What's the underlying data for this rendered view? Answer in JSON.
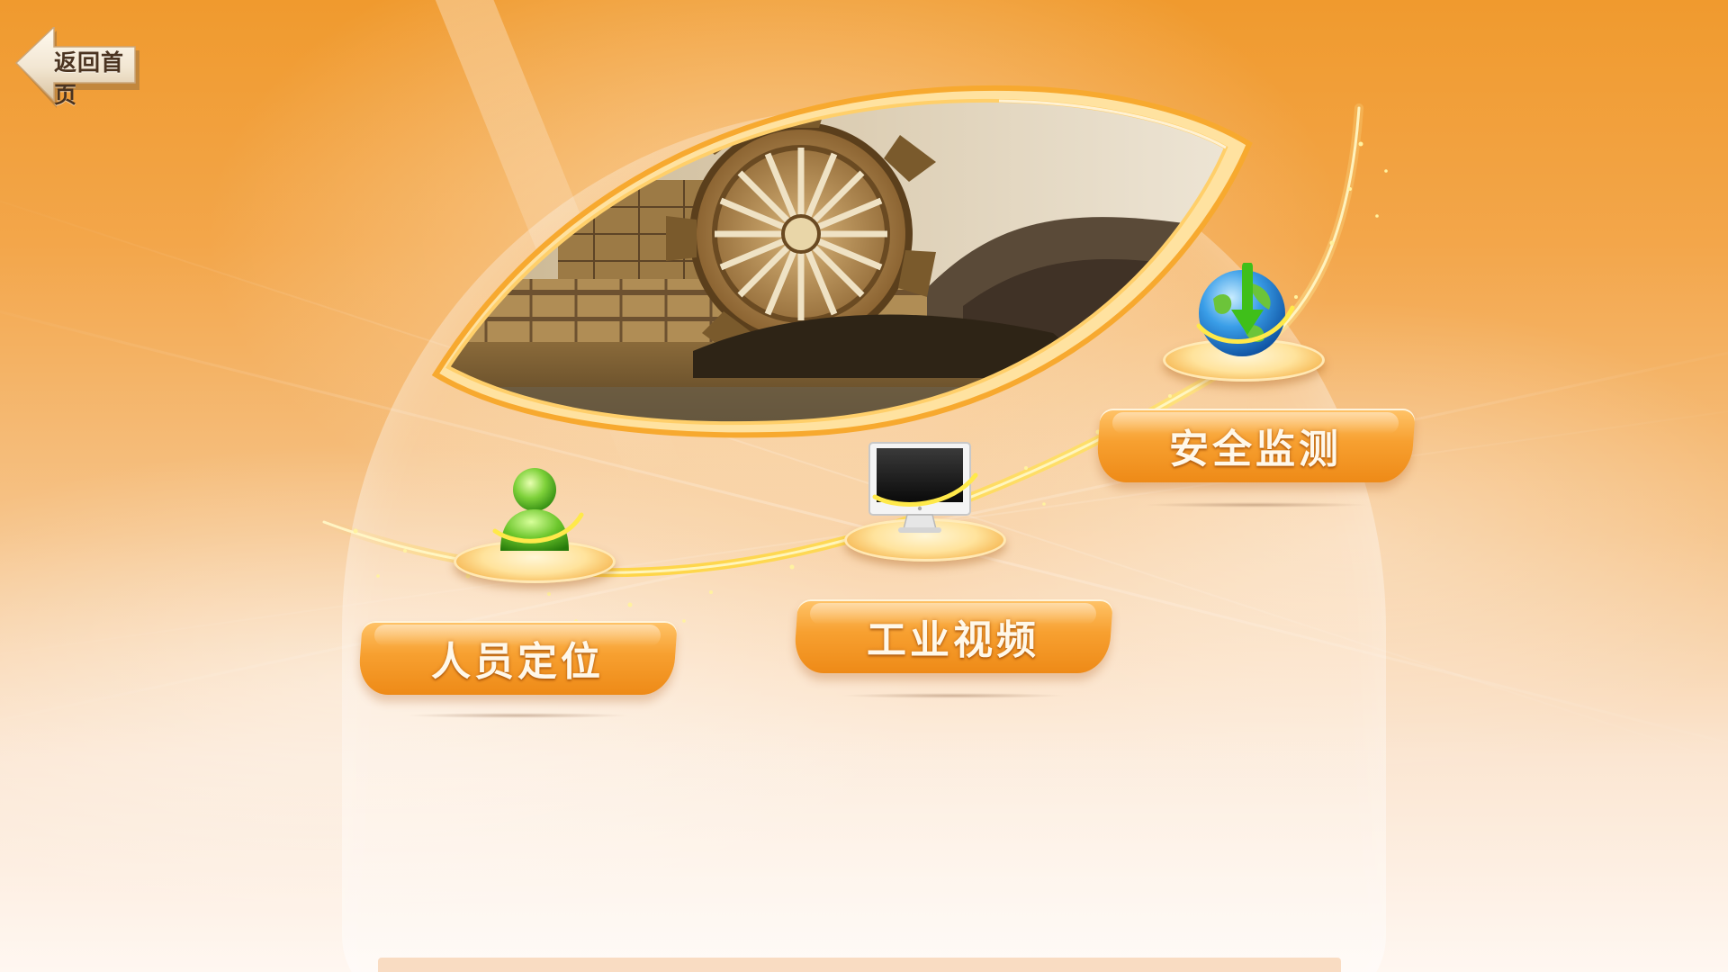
{
  "header": {
    "back_label": "返回首页"
  },
  "nav": {
    "personnel": {
      "label": "人员定位",
      "icon": "person-icon"
    },
    "video": {
      "label": "工业视频",
      "icon": "monitor-icon"
    },
    "safety": {
      "label": "安全监测",
      "icon": "globe-icon"
    }
  },
  "banner": {
    "image": "bucket-wheel-excavator-photo"
  },
  "colors": {
    "background_top": "#f09a2e",
    "background_bottom": "#fff7f1",
    "button_orange": "#f7a030",
    "button_text": "#fff8ea",
    "trail_yellow": "#ffd43a"
  }
}
